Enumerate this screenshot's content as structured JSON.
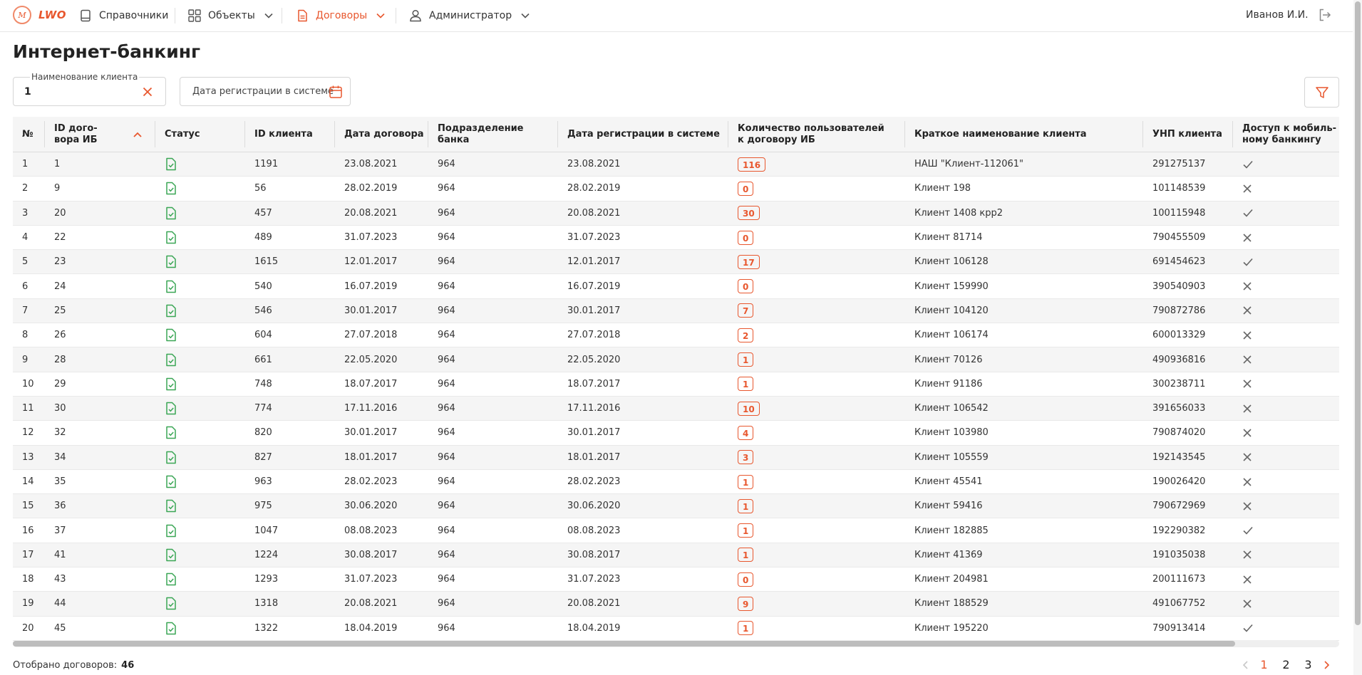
{
  "header": {
    "logo_mark": "M",
    "logo_text": "LWO",
    "nav": [
      {
        "label": "Справочники"
      },
      {
        "label": "Объекты"
      },
      {
        "label": "Договоры"
      },
      {
        "label": "Администратор"
      }
    ],
    "active_nav": "Договоры",
    "user_name": "Иванов И.И."
  },
  "page": {
    "title": "Интернет-банкинг"
  },
  "filters": {
    "client_label": "Наименование клиента",
    "client_value": "1",
    "date_placeholder": "Дата регистрации в системе"
  },
  "colors": {
    "accent": "#e8572e",
    "status_icon": "#3aa655",
    "row_alt": "#f5f5f5"
  },
  "table": {
    "columns": [
      "№",
      "ID дого-\nвора ИБ",
      "Статус",
      "ID клиента",
      "Дата договора",
      "Подразделение банка",
      "Дата регистрации в системе",
      "Количество пользователей\nк договору ИБ",
      "Краткое наименование клиента",
      "УНП клиента",
      "Доступ к мобиль-\nному банкингу"
    ],
    "sort_column": "ID дого-\nвора ИБ",
    "sort_direction": "asc",
    "rows": [
      {
        "n": "1",
        "id": "1",
        "client_id": "1191",
        "date": "23.08.2021",
        "dept": "964",
        "reg_date": "23.08.2021",
        "users": "116",
        "name": "НАШ \"Клиент-112061\"",
        "unp": "291275137",
        "mobile": true
      },
      {
        "n": "2",
        "id": "9",
        "client_id": "56",
        "date": "28.02.2019",
        "dept": "964",
        "reg_date": "28.02.2019",
        "users": "0",
        "name": "Клиент 198",
        "unp": "101148539",
        "mobile": false
      },
      {
        "n": "3",
        "id": "20",
        "client_id": "457",
        "date": "20.08.2021",
        "dept": "964",
        "reg_date": "20.08.2021",
        "users": "30",
        "name": "Клиент 1408 крр2",
        "unp": "100115948",
        "mobile": true
      },
      {
        "n": "4",
        "id": "22",
        "client_id": "489",
        "date": "31.07.2023",
        "dept": "964",
        "reg_date": "31.07.2023",
        "users": "0",
        "name": "Клиент 81714",
        "unp": "790455509",
        "mobile": false
      },
      {
        "n": "5",
        "id": "23",
        "client_id": "1615",
        "date": "12.01.2017",
        "dept": "964",
        "reg_date": "12.01.2017",
        "users": "17",
        "name": "Клиент 106128",
        "unp": "691454623",
        "mobile": true
      },
      {
        "n": "6",
        "id": "24",
        "client_id": "540",
        "date": "16.07.2019",
        "dept": "964",
        "reg_date": "16.07.2019",
        "users": "0",
        "name": "Клиент 159990",
        "unp": "390540903",
        "mobile": false
      },
      {
        "n": "7",
        "id": "25",
        "client_id": "546",
        "date": "30.01.2017",
        "dept": "964",
        "reg_date": "30.01.2017",
        "users": "7",
        "name": "Клиент 104120",
        "unp": "790872786",
        "mobile": false
      },
      {
        "n": "8",
        "id": "26",
        "client_id": "604",
        "date": "27.07.2018",
        "dept": "964",
        "reg_date": "27.07.2018",
        "users": "2",
        "name": "Клиент 106174",
        "unp": "600013329",
        "mobile": false
      },
      {
        "n": "9",
        "id": "28",
        "client_id": "661",
        "date": "22.05.2020",
        "dept": "964",
        "reg_date": "22.05.2020",
        "users": "1",
        "name": "Клиент 70126",
        "unp": "490936816",
        "mobile": false
      },
      {
        "n": "10",
        "id": "29",
        "client_id": "748",
        "date": "18.07.2017",
        "dept": "964",
        "reg_date": "18.07.2017",
        "users": "1",
        "name": "Клиент 91186",
        "unp": "300238711",
        "mobile": false
      },
      {
        "n": "11",
        "id": "30",
        "client_id": "774",
        "date": "17.11.2016",
        "dept": "964",
        "reg_date": "17.11.2016",
        "users": "10",
        "name": "Клиент 106542",
        "unp": "391656033",
        "mobile": false
      },
      {
        "n": "12",
        "id": "32",
        "client_id": "820",
        "date": "30.01.2017",
        "dept": "964",
        "reg_date": "30.01.2017",
        "users": "4",
        "name": "Клиент 103980",
        "unp": "790874020",
        "mobile": false
      },
      {
        "n": "13",
        "id": "34",
        "client_id": "827",
        "date": "18.01.2017",
        "dept": "964",
        "reg_date": "18.01.2017",
        "users": "3",
        "name": "Клиент 105559",
        "unp": "192143545",
        "mobile": false
      },
      {
        "n": "14",
        "id": "35",
        "client_id": "963",
        "date": "28.02.2023",
        "dept": "964",
        "reg_date": "28.02.2023",
        "users": "1",
        "name": "Клиент 45541",
        "unp": "190026420",
        "mobile": false
      },
      {
        "n": "15",
        "id": "36",
        "client_id": "975",
        "date": "30.06.2020",
        "dept": "964",
        "reg_date": "30.06.2020",
        "users": "1",
        "name": "Клиент 59416",
        "unp": "790672969",
        "mobile": false
      },
      {
        "n": "16",
        "id": "37",
        "client_id": "1047",
        "date": "08.08.2023",
        "dept": "964",
        "reg_date": "08.08.2023",
        "users": "1",
        "name": "Клиент 182885",
        "unp": "192290382",
        "mobile": true
      },
      {
        "n": "17",
        "id": "41",
        "client_id": "1224",
        "date": "30.08.2017",
        "dept": "964",
        "reg_date": "30.08.2017",
        "users": "1",
        "name": "Клиент 41369",
        "unp": "191035038",
        "mobile": false
      },
      {
        "n": "18",
        "id": "43",
        "client_id": "1293",
        "date": "31.07.2023",
        "dept": "964",
        "reg_date": "31.07.2023",
        "users": "0",
        "name": "Клиент 204981",
        "unp": "200111673",
        "mobile": false
      },
      {
        "n": "19",
        "id": "44",
        "client_id": "1318",
        "date": "20.08.2021",
        "dept": "964",
        "reg_date": "20.08.2021",
        "users": "9",
        "name": "Клиент 188529",
        "unp": "491067752",
        "mobile": false
      },
      {
        "n": "20",
        "id": "45",
        "client_id": "1322",
        "date": "18.04.2019",
        "dept": "964",
        "reg_date": "18.04.2019",
        "users": "1",
        "name": "Клиент 195220",
        "unp": "790913414",
        "mobile": true
      }
    ]
  },
  "footer": {
    "count_label": "Отобрано договоров:",
    "count_value": "46",
    "pages": [
      "1",
      "2",
      "3"
    ],
    "current_page": "1"
  }
}
